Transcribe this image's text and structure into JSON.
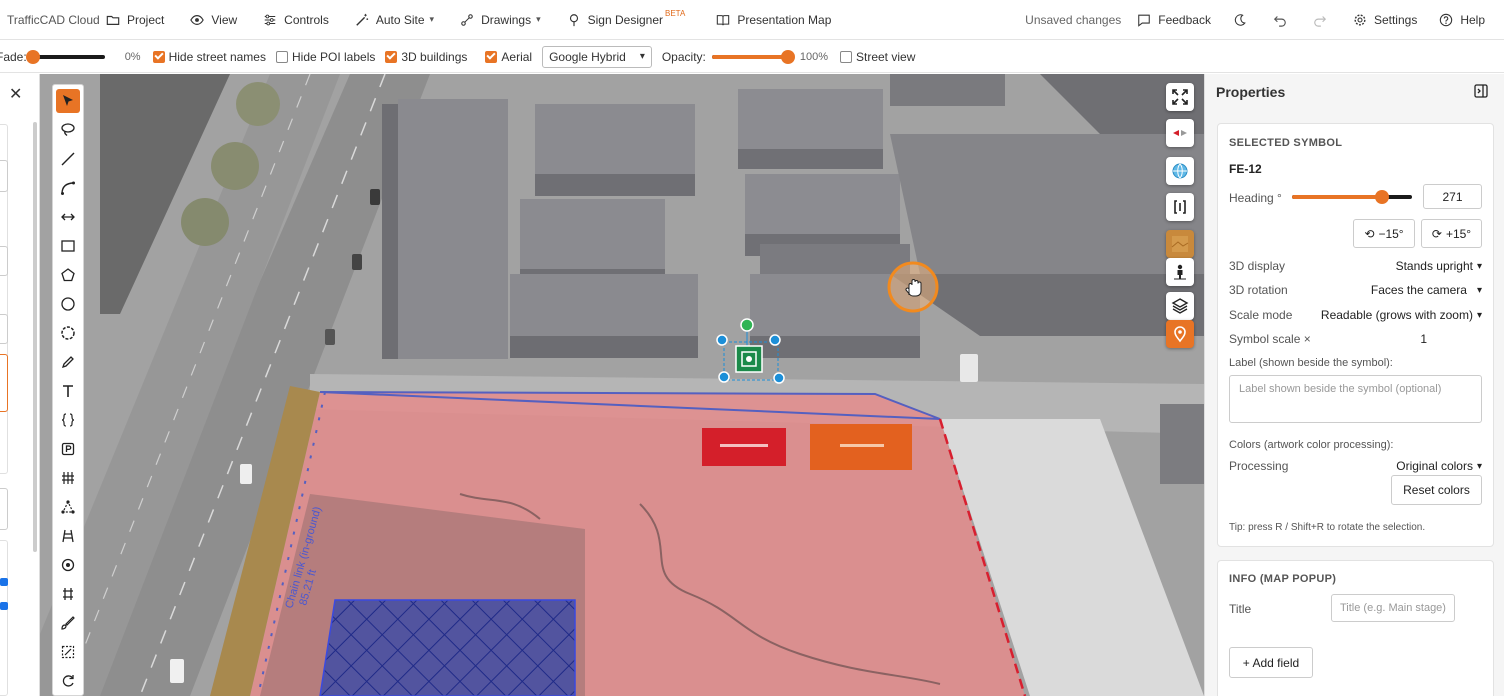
{
  "app": {
    "brand": "TrafficCAD Cloud"
  },
  "menu": {
    "project": "Project",
    "view": "View",
    "controls": "Controls",
    "auto_site": "Auto Site",
    "drawings": "Drawings",
    "sign_designer": "Sign Designer",
    "beta_badge": "BETA",
    "presentation_map": "Presentation Map",
    "status": "Unsaved changes",
    "feedback": "Feedback",
    "settings": "Settings",
    "help": "Help"
  },
  "options": {
    "fade_label": "Fade:",
    "fade_value": 0,
    "fade_pct": "0%",
    "hide_street_names": {
      "label": "Hide street names",
      "checked": true
    },
    "hide_poi_labels": {
      "label": "Hide POI labels",
      "checked": false
    },
    "buildings_3d": {
      "label": "3D buildings",
      "checked": true
    },
    "aerial": {
      "label": "Aerial",
      "checked": true
    },
    "basemap": "Google Hybrid",
    "opacity_label": "Opacity:",
    "opacity_value": 100,
    "opacity_pct": "100%",
    "street_view": {
      "label": "Street view",
      "checked": false
    }
  },
  "map": {
    "fence_label": "Chain link (in-ground)",
    "fence_length": "85.21 ft"
  },
  "properties": {
    "title": "Properties",
    "selected_symbol": {
      "section": "SELECTED SYMBOL",
      "symbol_id": "FE-12",
      "heading_label": "Heading °",
      "heading_value": "271",
      "heading_fraction": 0.75,
      "rotate_minus": "−15°",
      "rotate_plus": "+15°",
      "display_3d_label": "3D display",
      "display_3d_value": "Stands upright",
      "rotation_3d_label": "3D rotation",
      "rotation_3d_value": "Faces the camera",
      "scale_mode_label": "Scale mode",
      "scale_mode_value": "Readable (grows with zoom)",
      "symbol_scale_label": "Symbol scale ×",
      "symbol_scale_value": "1",
      "label_caption": "Label (shown beside the symbol):",
      "label_placeholder": "Label shown beside the symbol (optional)",
      "colors_caption": "Colors (artwork color processing):",
      "processing_label": "Processing",
      "processing_value": "Original colors",
      "reset_colors": "Reset colors",
      "tip": "Tip: press R / Shift+R to rotate the selection."
    },
    "info": {
      "section": "INFO (MAP POPUP)",
      "title_label": "Title",
      "title_placeholder": "Title (e.g. Main stage)",
      "add_field": "+ Add field"
    }
  },
  "colors": {
    "accent": "#e87425"
  }
}
